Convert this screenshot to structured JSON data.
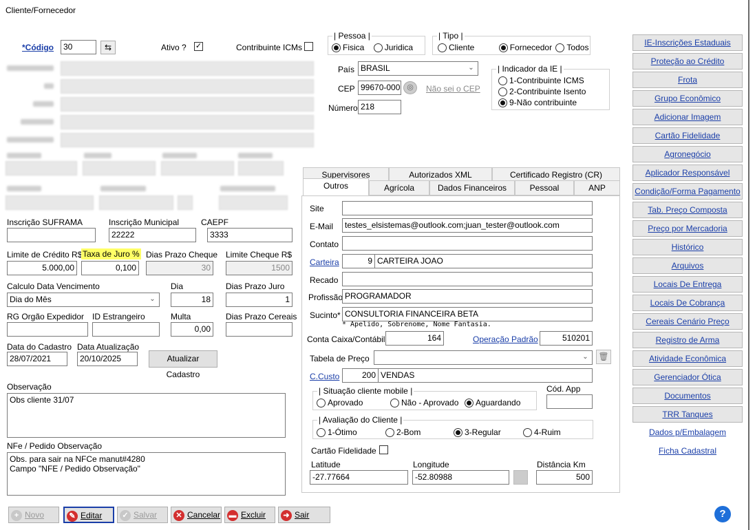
{
  "window": {
    "title": "Cliente/Fornecedor"
  },
  "code": {
    "label": "*Código",
    "value": "30"
  },
  "ativo": {
    "label": "Ativo ?",
    "checked": "✓"
  },
  "contribuinte_icms": {
    "label": "Contribuinte ICMs"
  },
  "pessoa": {
    "caption": "Pessoa",
    "options": [
      "Fisica",
      "Juridica"
    ],
    "selected": 0
  },
  "tipo": {
    "caption": "Tipo",
    "options": [
      "Cliente",
      "Fornecedor",
      "Todos"
    ],
    "selected": 1
  },
  "address": {
    "pais_label": "País",
    "pais_value": "BRASIL",
    "cep_label": "CEP",
    "cep_value": "99670-000",
    "cep_link": "Não sei o CEP",
    "numero_label": "Número",
    "numero_value": "218"
  },
  "indicador_ie": {
    "caption": "Indicador da IE",
    "options": [
      "1-Contribuinte ICMS",
      "2-Contribuinte Isento",
      "9-Não contribuinte"
    ],
    "selected": 2
  },
  "fields": {
    "suframa_label": "Inscrição SUFRAMA",
    "suframa_value": "",
    "municipal_label": "Inscrição Municipal",
    "municipal_value": "22222",
    "caepf_label": "CAEPF",
    "caepf_value": "3333",
    "limite_credito_label": "Limite de Crédito R$",
    "limite_credito_value": "5.000,00",
    "taxa_juro_label": "Taxa de Juro %",
    "taxa_juro_value": "0,100",
    "dias_prazo_cheque_label": "Dias Prazo Cheque",
    "dias_prazo_cheque_value": "30",
    "limite_cheque_label": "Limite Cheque R$",
    "limite_cheque_value": "1500",
    "calculo_label": "Calculo Data Vencimento",
    "calculo_value": "Dia do Mês",
    "dia_label": "Dia",
    "dia_value": "18",
    "dias_prazo_juro_label": "Dias Prazo Juro",
    "dias_prazo_juro_value": "1",
    "rg_label": "RG Orgão Expedidor",
    "rg_value": "",
    "id_estrangeiro_label": "ID Estrangeiro",
    "id_estrangeiro_value": "",
    "multa_label": "Multa",
    "multa_value": "0,00",
    "dias_prazo_cereais_label": "Dias Prazo Cereais",
    "dias_prazo_cereais_value": "",
    "data_cadastro_label": "Data do Cadastro",
    "data_cadastro_value": "28/07/2021",
    "data_atualizacao_label": "Data Atualização",
    "data_atualizacao_value": "20/10/2025",
    "atualizar_button": "Atualizar Cadastro",
    "observacao_label": "Observação",
    "observacao_value": "Obs cliente 31/07",
    "nfe_label": "NFe / Pedido Observação",
    "nfe_value": "Obs. para sair na NFCe manut#4280\nCampo \"NFE / Pedido Observação\""
  },
  "tabs": {
    "row1": [
      "Supervisores",
      "Autorizados XML",
      "Certificado Registro (CR)"
    ],
    "row2": [
      "Outros",
      "Agrícola",
      "Dados Financeiros",
      "Pessoal",
      "ANP"
    ]
  },
  "outros": {
    "site_label": "Site",
    "site_value": "",
    "email_label": "E-Mail",
    "email_value": "testes_elsistemas@outlook.com;juan_tester@outlook.com",
    "contato_label": "Contato",
    "contato_value": "",
    "carteira_label": "Carteira",
    "carteira_code": "9",
    "carteira_name": "CARTEIRA JOAO",
    "recado_label": "Recado",
    "recado_value": "",
    "profissao_label": "Profissão",
    "profissao_value": "PROGRAMADOR",
    "sucinto_label": "Sucinto*",
    "sucinto_value": "CONSULTORIA FINANCEIRA BETA",
    "sucinto_hint": "* Apelido, Sobrenome, Nome Fantasia.",
    "conta_label": "Conta Caixa/Contábil",
    "conta_value": "164",
    "operacao_label": "Operação Padrão",
    "operacao_value": "510201",
    "tabela_label": "Tabela de Preço",
    "tabela_value": "",
    "ccusto_label": "C.Custo",
    "ccusto_code": "200",
    "ccusto_name": "VENDAS",
    "situacao_caption": "Situação cliente mobile",
    "situacao_options": [
      "Aprovado",
      "Não - Aprovado",
      "Aguardando"
    ],
    "situacao_selected": 2,
    "cod_app_label": "Cód. App",
    "cod_app_value": "",
    "avaliacao_caption": "Avaliação do Cliente",
    "avaliacao_options": [
      "1-Ótimo",
      "2-Bom",
      "3-Regular",
      "4-Ruim"
    ],
    "avaliacao_selected": 2,
    "cartao_label": "Cartão Fidelidade",
    "latitude_label": "Latitude",
    "latitude_value": "-27.77664",
    "longitude_label": "Longitude",
    "longitude_value": "-52.80988",
    "distancia_label": "Distância Km",
    "distancia_value": "500"
  },
  "sidebar": {
    "buttons": [
      "IE-Inscrições Estaduais",
      "Proteção ao Crédito",
      "Frota",
      "Grupo Econômico",
      "Adicionar Imagem",
      "Cartão Fidelidade",
      "Agronegócio",
      "Aplicador Responsável",
      "Condição/Forma Pagamento",
      "Tab. Preço Composta",
      "Preço por Mercadoria",
      "Histórico",
      "Arquivos",
      "Locais De Entrega",
      "Locais De Cobrança",
      "Cereais Cenário Preço",
      "Registro de Arma",
      "Atividade Econômica",
      "Gerenciador Ótica",
      "Documentos",
      "TRR Tanques"
    ],
    "links": [
      "Dados p/Embalagem",
      "Ficha Cadastral"
    ]
  },
  "toolbar": {
    "novo": "Novo",
    "editar": "Editar",
    "salvar": "Salvar",
    "cancelar": "Cancelar",
    "excluir": "Excluir",
    "sair": "Sair"
  },
  "colors": {
    "link": "#1a3ea8",
    "highlight": "#ffff66",
    "help": "#1e6fd9"
  }
}
